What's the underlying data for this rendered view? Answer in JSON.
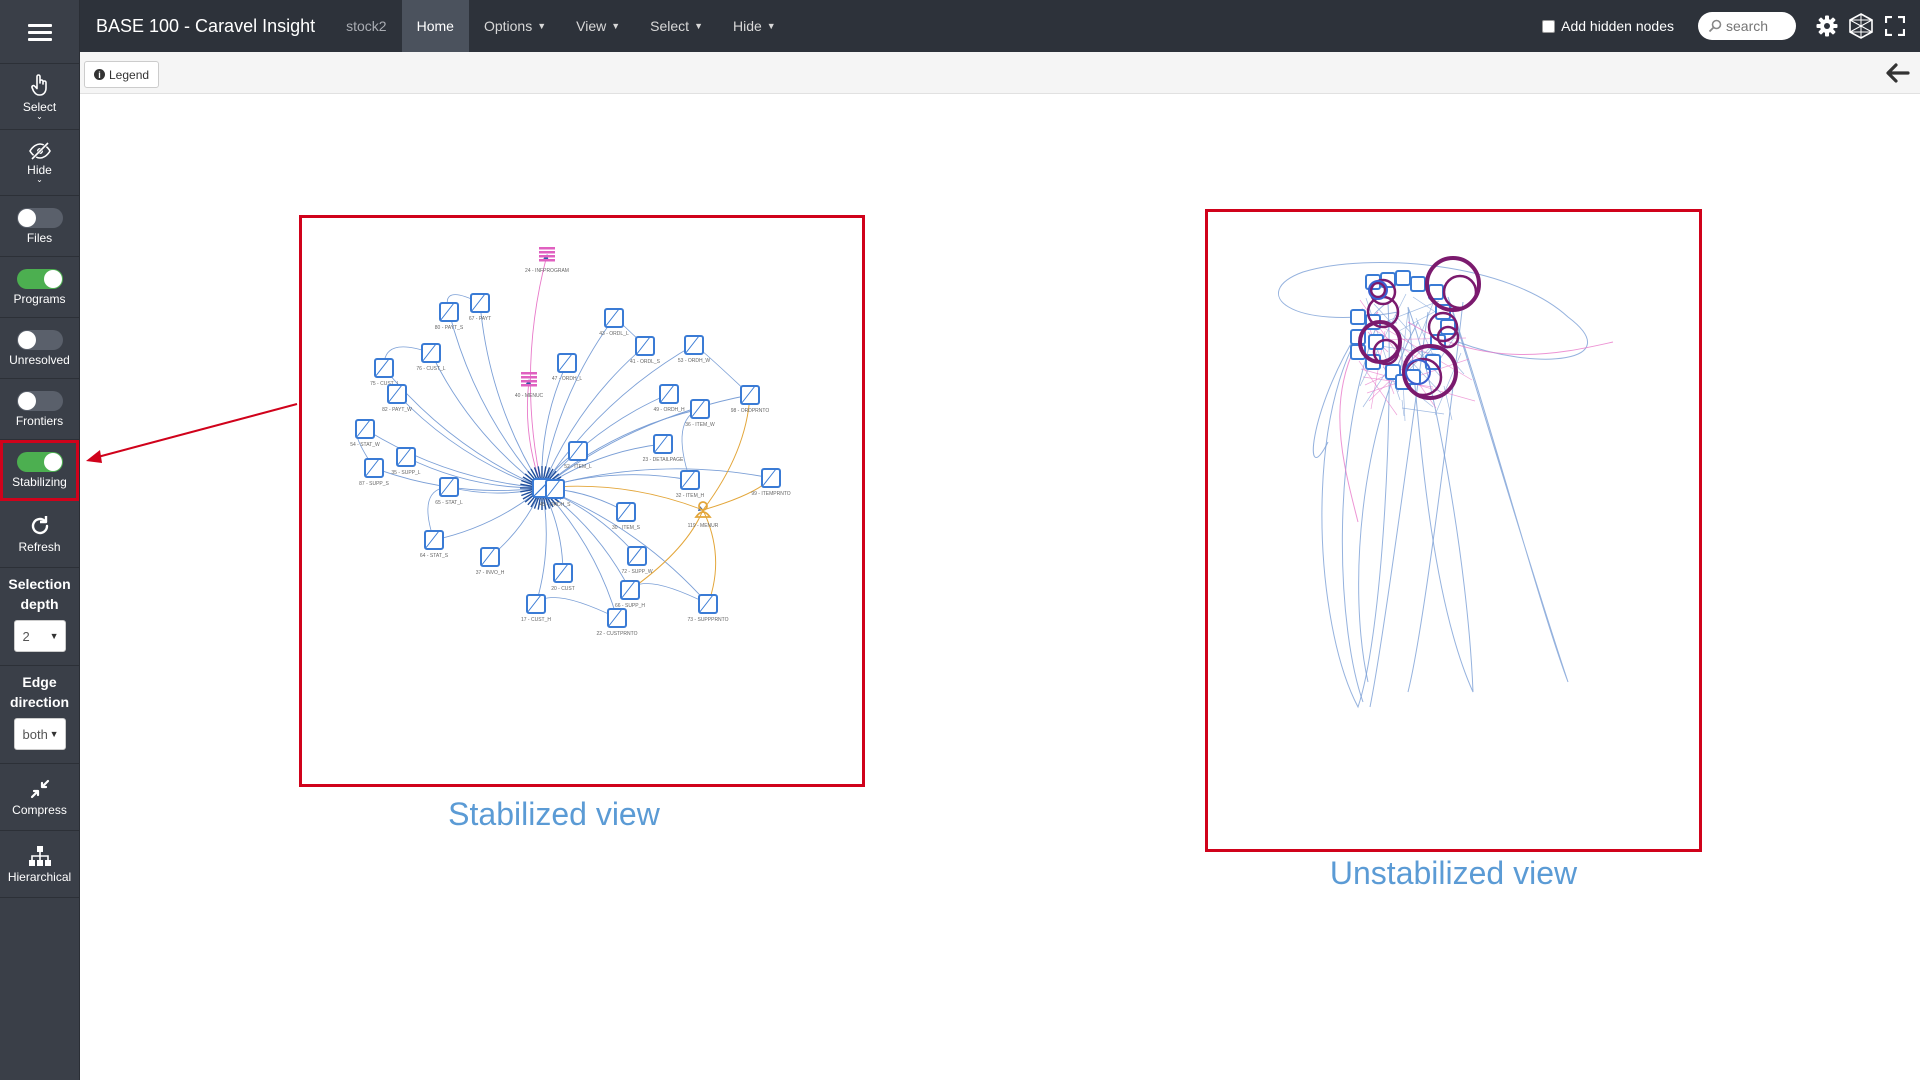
{
  "app": {
    "title": "BASE 100 - Caravel Insight",
    "project": "stock2"
  },
  "nav": {
    "home": "Home",
    "options": "Options",
    "view": "View",
    "select": "Select",
    "hide": "Hide"
  },
  "topbar": {
    "add_hidden_nodes": "Add hidden nodes",
    "search_placeholder": "search",
    "add_hidden_nodes_checked": false
  },
  "toolbar": {
    "legend": "Legend"
  },
  "sidebar": {
    "select": "Select",
    "hide": "Hide",
    "toggles": [
      {
        "label": "Files",
        "on": false
      },
      {
        "label": "Programs",
        "on": true
      },
      {
        "label": "Unresolved",
        "on": false
      },
      {
        "label": "Frontiers",
        "on": false
      },
      {
        "label": "Stabilizing",
        "on": true
      }
    ],
    "refresh": "Refresh",
    "selection_depth_label": "Selection depth",
    "selection_depth_value": "2",
    "edge_direction_label": "Edge direction",
    "edge_direction_value": "both",
    "compress": "Compress",
    "hierarchical": "Hierarchical"
  },
  "captions": {
    "stabilized": "Stabilized view",
    "unstabilized": "Unstabilized view"
  },
  "graph": {
    "center_node": "",
    "nodes": [
      {
        "id": "n24",
        "label": "24 - INFPROGRAM",
        "kind": "file"
      },
      {
        "id": "n80",
        "label": "80 - PAYT_S"
      },
      {
        "id": "n67",
        "label": "67 - PAYT"
      },
      {
        "id": "n76",
        "label": "76 - CUST_L"
      },
      {
        "id": "n40",
        "label": "40 - MENUC",
        "kind": "file"
      },
      {
        "id": "n43",
        "label": "43 - ORDL_L"
      },
      {
        "id": "n41",
        "label": "41 - ORDL_S"
      },
      {
        "id": "n53",
        "label": "53 - ORDH_W"
      },
      {
        "id": "n47",
        "label": "47 - ORDH_L"
      },
      {
        "id": "n75",
        "label": "75 - CUST_I"
      },
      {
        "id": "n82",
        "label": "82 - PAYT_W"
      },
      {
        "id": "n49",
        "label": "49 - ORDH_H"
      },
      {
        "id": "n98",
        "label": "98 - ORDPRNTO"
      },
      {
        "id": "n36",
        "label": "36 - ITEM_W"
      },
      {
        "id": "n54",
        "label": "54 - STAT_W"
      },
      {
        "id": "n35",
        "label": "35 - SUPP_L"
      },
      {
        "id": "n87",
        "label": "87 - SUPP_S"
      },
      {
        "id": "n52",
        "label": "52 - ITEM_L"
      },
      {
        "id": "n23",
        "label": "23 - DETAILPAGE"
      },
      {
        "id": "n99",
        "label": "99 - ITEMPRNTO"
      },
      {
        "id": "n32",
        "label": "32 - ITEM_H"
      },
      {
        "id": "n65",
        "label": "65 - STAT_L"
      },
      {
        "id": "n45",
        "label": "45 - ORDH_S"
      },
      {
        "id": "n119",
        "label": "119 - MENUR",
        "kind": "user"
      },
      {
        "id": "n30",
        "label": "30 - ITEM_S"
      },
      {
        "id": "n64",
        "label": "64 - STAT_S"
      },
      {
        "id": "n37",
        "label": "37 - INVO_H"
      },
      {
        "id": "n72",
        "label": "72 - SUPP_W"
      },
      {
        "id": "n20",
        "label": "20 - CUST"
      },
      {
        "id": "n66",
        "label": "66 - SUPP_H"
      },
      {
        "id": "n17",
        "label": "17 - CUST_H"
      },
      {
        "id": "n22",
        "label": "22 - CUSTPRNTO"
      },
      {
        "id": "n73",
        "label": "73 - SUPPPRNTO"
      }
    ]
  },
  "colors": {
    "highlight": "#d0021b",
    "node": "#3a7bd5",
    "edge": "#7b9fd6",
    "file_edge": "#e879c9",
    "user": "#e3a63a",
    "caption": "#5b9bd5",
    "purple": "#7b1a6e"
  }
}
